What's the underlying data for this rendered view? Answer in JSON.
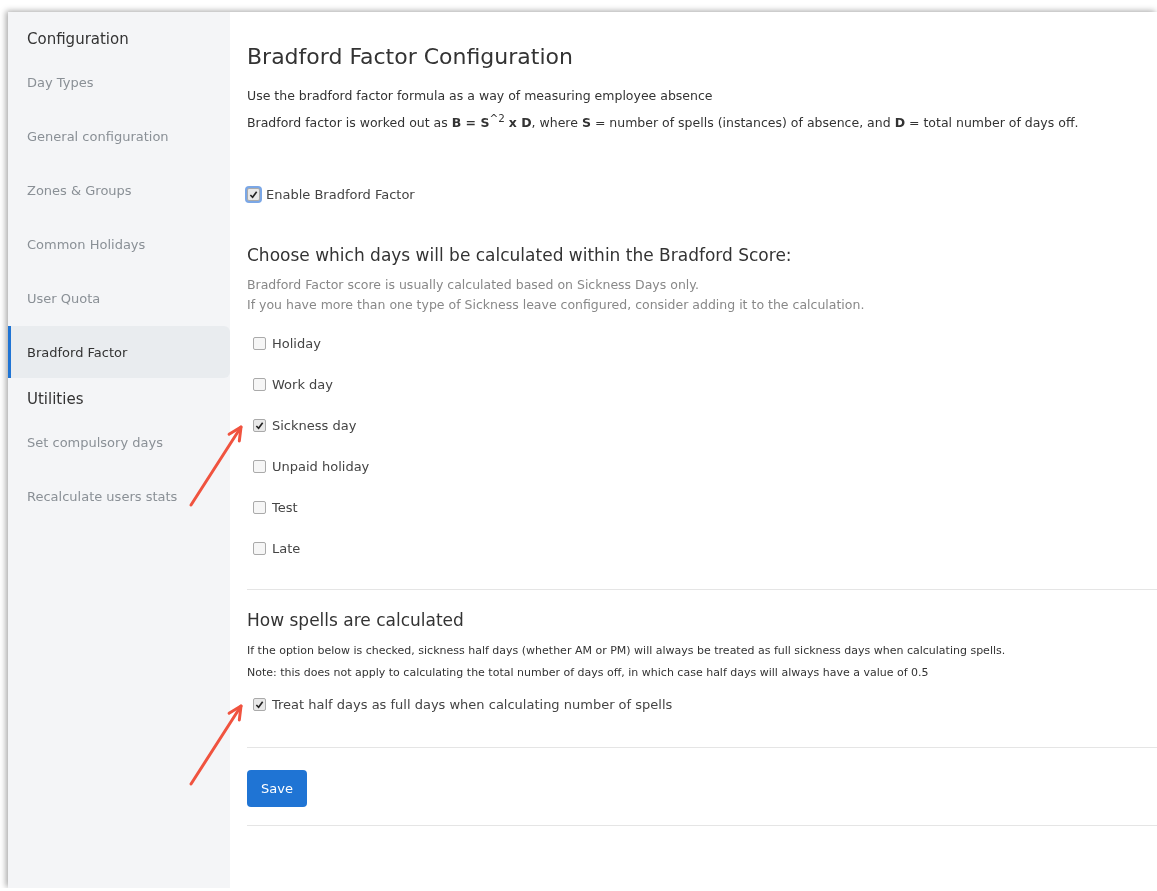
{
  "sidebar": {
    "sections": [
      {
        "heading": "Configuration",
        "items": [
          {
            "label": "Day Types",
            "selected": false
          },
          {
            "label": "General configuration",
            "selected": false
          },
          {
            "label": "Zones & Groups",
            "selected": false
          },
          {
            "label": "Common Holidays",
            "selected": false
          },
          {
            "label": "User Quota",
            "selected": false
          },
          {
            "label": "Bradford Factor",
            "selected": true
          }
        ]
      },
      {
        "heading": "Utilities",
        "items": [
          {
            "label": "Set compulsory days",
            "selected": false
          },
          {
            "label": "Recalculate users stats",
            "selected": false
          }
        ]
      }
    ]
  },
  "page": {
    "title": "Bradford Factor Configuration",
    "intro": [
      "Use the bradford factor formula as a way of measuring employee absence",
      "Bradford factor is worked out as **B = S**$^{^2}$ **x D**, where **S** = number of spells (instances) of absence, and **D** = total number of days off."
    ],
    "enable": {
      "label": "Enable Bradford Factor",
      "checked": true
    },
    "days_section": {
      "title": "Choose which days will be calculated within the Bradford Score:",
      "notes": [
        "Bradford Factor score is usually calculated based on Sickness Days only.",
        "If you have more than one type of Sickness leave configured, consider adding it to the calculation."
      ],
      "options": [
        {
          "label": "Holiday",
          "checked": false
        },
        {
          "label": "Work day",
          "checked": false
        },
        {
          "label": "Sickness day",
          "checked": true,
          "annotated": true
        },
        {
          "label": "Unpaid holiday",
          "checked": false
        },
        {
          "label": "Test",
          "checked": false
        },
        {
          "label": "Late",
          "checked": false
        }
      ]
    },
    "spells_section": {
      "title": "How spells are calculated",
      "notes": [
        "If the option below is checked, sickness half days (whether AM or PM) will always be treated as full sickness days when calculating spells.",
        "Note: this does not apply to calculating the total number of days off, in which case half days will always have a value of 0.5"
      ],
      "option": {
        "label": "Treat half days as full days when calculating number of spells",
        "checked": true,
        "annotated": true
      }
    },
    "save_button": "Save"
  }
}
